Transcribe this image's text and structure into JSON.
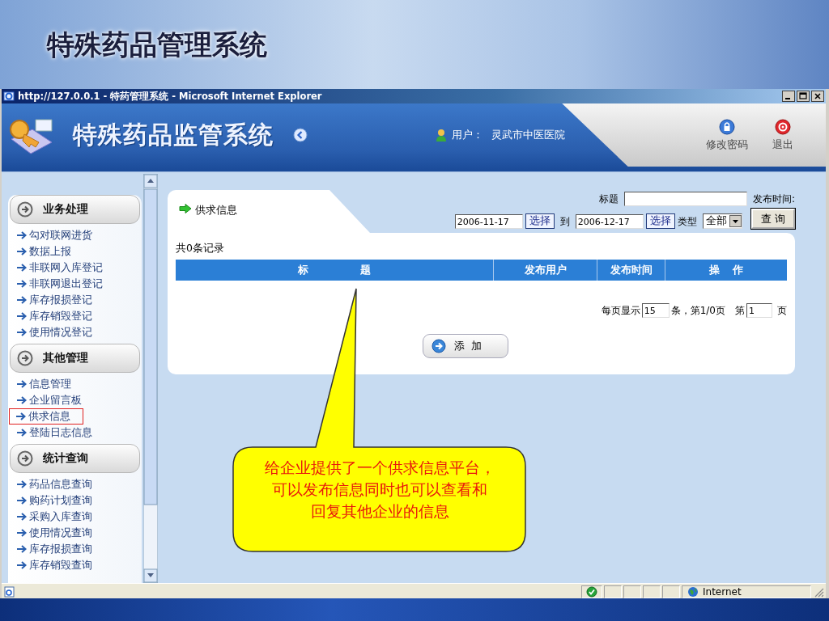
{
  "slide": {
    "title": "特殊药品管理系统"
  },
  "window": {
    "title": "http://127.0.0.1 - 特药管理系统 - Microsoft Internet Explorer"
  },
  "header": {
    "app_name": "特殊药品监管系统",
    "user_label": "用户：",
    "user_name": "灵武市中医医院",
    "actions": [
      {
        "kind": "password",
        "label": "修改密码"
      },
      {
        "kind": "logout",
        "label": "退出"
      }
    ]
  },
  "sidebar": {
    "groups": [
      {
        "label": "业务处理",
        "items": [
          {
            "label": "勾对联网进货",
            "selected": false
          },
          {
            "label": "数据上报",
            "selected": false
          },
          {
            "label": "非联网入库登记",
            "selected": false
          },
          {
            "label": "非联网退出登记",
            "selected": false
          },
          {
            "label": "库存报损登记",
            "selected": false
          },
          {
            "label": "库存销毁登记",
            "selected": false
          },
          {
            "label": "使用情况登记",
            "selected": false
          }
        ]
      },
      {
        "label": "其他管理",
        "items": [
          {
            "label": "信息管理",
            "selected": false
          },
          {
            "label": "企业留言板",
            "selected": false
          },
          {
            "label": "供求信息",
            "selected": true
          },
          {
            "label": "登陆日志信息",
            "selected": false
          }
        ]
      },
      {
        "label": "统计查询",
        "items": [
          {
            "label": "药品信息查询",
            "selected": false
          },
          {
            "label": "购药计划查询",
            "selected": false
          },
          {
            "label": "采购入库查询",
            "selected": false
          },
          {
            "label": "使用情况查询",
            "selected": false
          },
          {
            "label": "库存报损查询",
            "selected": false
          },
          {
            "label": "库存销毁查询",
            "selected": false
          }
        ]
      }
    ]
  },
  "panel": {
    "title": "供求信息",
    "filters": {
      "title_label": "标题",
      "time_label": "发布时间:",
      "start_date": "2006-11-17",
      "start_pick": "选择",
      "to_label": "到",
      "end_date": "2006-12-17",
      "end_pick": "选择",
      "type_label": "类型",
      "type_value": "全部",
      "query_button": "查 询"
    },
    "record_count": "共0条记录",
    "table": {
      "columns": [
        "标 题",
        "发布用户",
        "发布时间",
        "操 作"
      ]
    },
    "pagination": {
      "per_page_label": "每页显示",
      "per_page": "15",
      "page_info": "条，第1/0页",
      "page_label": "第",
      "page": "1",
      "page_suffix": "页"
    },
    "add_button": "添 加"
  },
  "callout": {
    "lines": [
      "给企业提供了一个供求信息平台，",
      "可以发布信息同时也可以查看和",
      "回复其他企业的信息"
    ]
  },
  "status_bar": {
    "zone": "Internet"
  }
}
